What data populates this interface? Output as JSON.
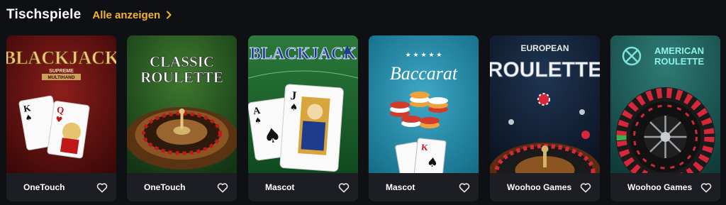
{
  "section": {
    "title": "Tischspiele",
    "show_all_label": "Alle anzeigen"
  },
  "colors": {
    "background": "#0f1014",
    "card": "#1d1e24",
    "accent": "#f2b52d"
  },
  "games": [
    {
      "logo_line1": "BLACKJACK",
      "logo_line2": "SUPREME",
      "logo_line3": "MULTIHAND",
      "provider": "OneTouch",
      "favorite_icon": "heart-outline-icon"
    },
    {
      "logo_line1": "CLASSIC",
      "logo_line2": "ROULETTE",
      "provider": "OneTouch",
      "favorite_icon": "heart-outline-icon"
    },
    {
      "logo_line1": "BLACKJACK",
      "provider": "Mascot",
      "favorite_icon": "heart-outline-icon"
    },
    {
      "logo_line1": "Baccarat",
      "provider": "Mascot",
      "favorite_icon": "heart-outline-icon"
    },
    {
      "logo_line1": "EUROPEAN",
      "logo_line2": "ROULETTE",
      "provider": "Woohoo Games",
      "favorite_icon": "heart-outline-icon"
    },
    {
      "logo_line1": "AMERICAN",
      "logo_line2": "ROULETTE",
      "provider": "Woohoo Games",
      "favorite_icon": "heart-outline-icon"
    }
  ]
}
